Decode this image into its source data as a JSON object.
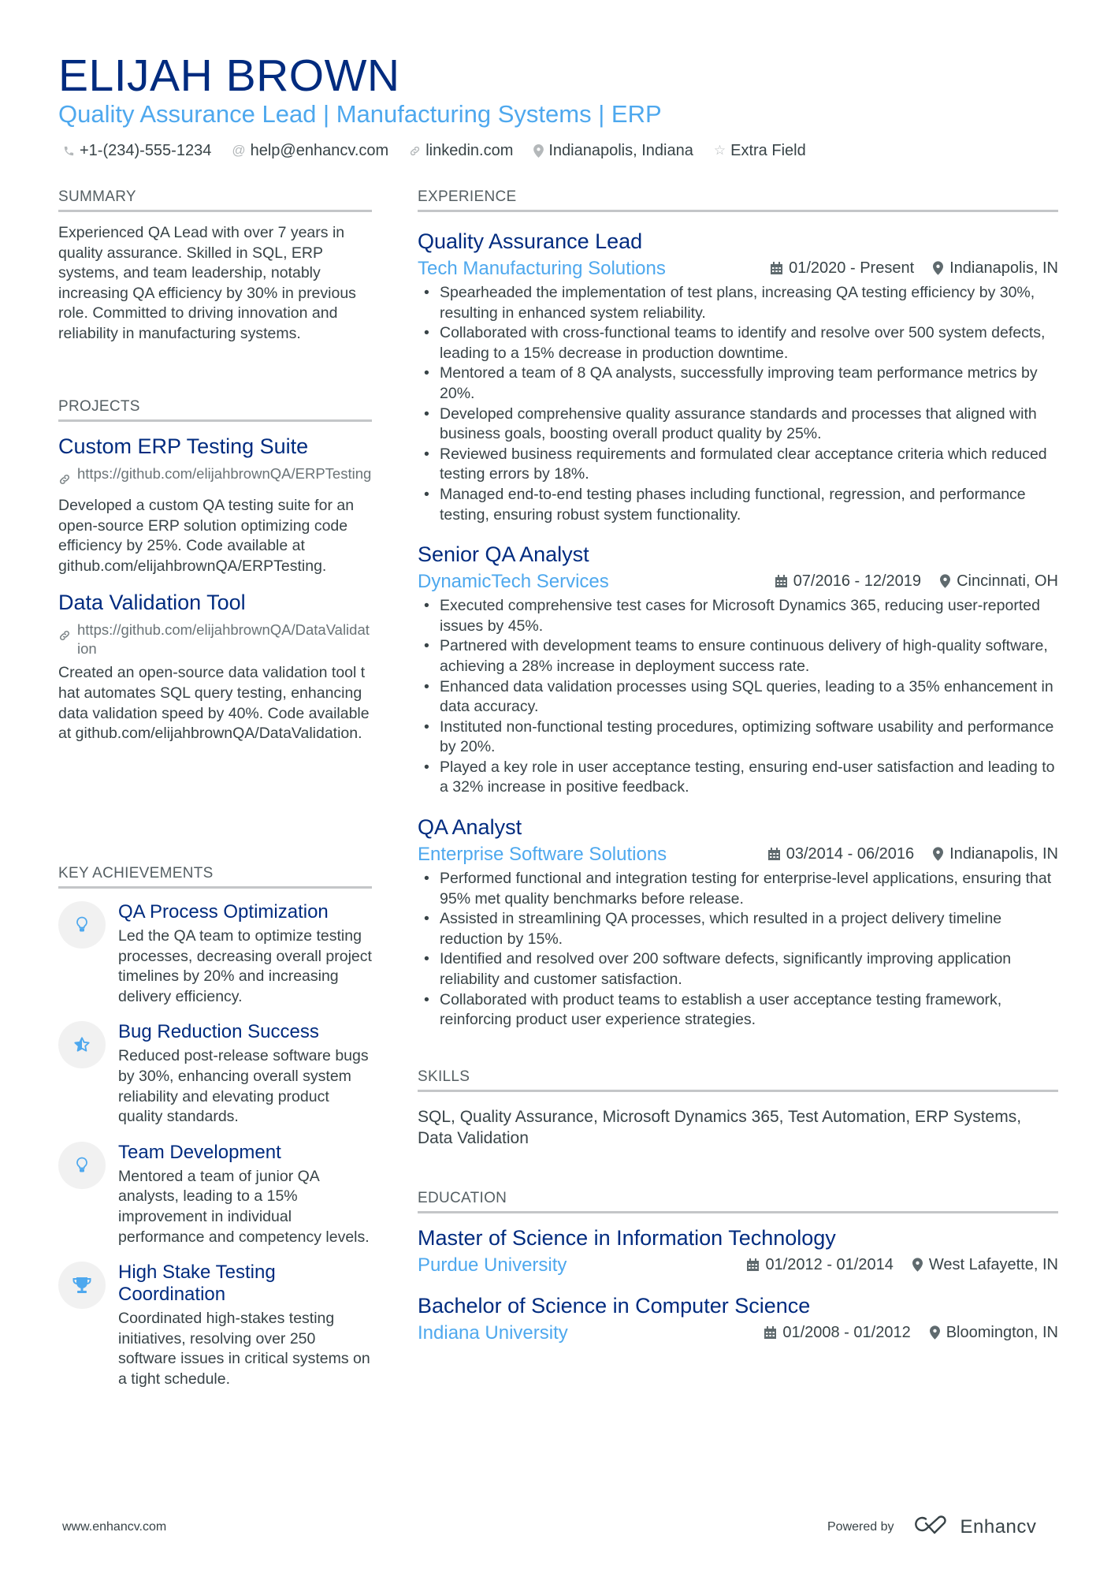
{
  "header": {
    "name": "ELIJAH BROWN",
    "headline": "Quality Assurance Lead | Manufacturing Systems | ERP",
    "contacts": [
      {
        "icon": "phone-icon",
        "text": "+1-(234)-555-1234"
      },
      {
        "icon": "at-icon",
        "text": "help@enhancv.com"
      },
      {
        "icon": "link-icon",
        "text": "linkedin.com"
      },
      {
        "icon": "location-icon",
        "text": "Indianapolis, Indiana"
      },
      {
        "icon": "star-icon",
        "text": "Extra Field"
      }
    ]
  },
  "colors": {
    "name": "#002b7f",
    "accent": "#4ea8ee",
    "text": "#384347",
    "section_rule": "#c4c6c8",
    "icon_bg": "#f1f1f1"
  },
  "summary": {
    "title": "SUMMARY",
    "text": "Experienced QA Lead with over 7 years in quality assurance. Skilled in SQL, ERP systems, and team leadership, notably increasing QA efficiency by 30% in previous role. Committed to driving innovation and reliability in manufacturing systems."
  },
  "projects": {
    "title": "PROJECTS",
    "items": [
      {
        "title": "Custom ERP Testing Suite",
        "link": "https://github.com/elijahbrownQA/ERPTesting",
        "description": "Developed a custom QA testing suite for an open-source ERP solution optimizing code efficiency by 25%. Code available at github.com/elijahbrownQA/ERPTesting."
      },
      {
        "title": "Data Validation Tool",
        "link": "https://github.com/elijahbrownQA/DataValidation",
        "description": "Created an open-source data validation tool that automates SQL query testing, enhancing data validation speed by 40%. Code available at github.com/elijahbrownQA/DataValidation."
      }
    ]
  },
  "achievements": {
    "title": "KEY ACHIEVEMENTS",
    "items": [
      {
        "icon": "lightbulb-icon",
        "title": "QA Process Optimization",
        "description": "Led the QA team to optimize testing processes, decreasing overall project timelines by 20% and increasing delivery efficiency."
      },
      {
        "icon": "star-half-icon",
        "title": "Bug Reduction Success",
        "description": "Reduced post-release software bugs by 30%, enhancing overall system reliability and elevating product quality standards."
      },
      {
        "icon": "lightbulb-icon",
        "title": "Team Development",
        "description": "Mentored a team of junior QA analysts, leading to a 15% improvement in individual performance and competency levels."
      },
      {
        "icon": "trophy-icon",
        "title": "High Stake Testing Coordination",
        "description": "Coordinated high-stakes testing initiatives, resolving over 250 software issues in critical systems on a tight schedule."
      }
    ]
  },
  "experience": {
    "title": "EXPERIENCE",
    "items": [
      {
        "role": "Quality Assurance Lead",
        "company": "Tech Manufacturing Solutions",
        "dates": "01/2020 - Present",
        "location": "Indianapolis, IN",
        "bullets": [
          "Spearheaded the implementation of test plans, increasing QA testing efficiency by 30%, resulting in enhanced system reliability.",
          "Collaborated with cross-functional teams to identify and resolve over 500 system defects, leading to a 15% decrease in production downtime.",
          "Mentored a team of 8 QA analysts, successfully improving team performance metrics by 20%.",
          "Developed comprehensive quality assurance standards and processes that aligned with business goals, boosting overall product quality by 25%.",
          "Reviewed business requirements and formulated clear acceptance criteria which reduced testing errors by 18%.",
          "Managed end-to-end testing phases including functional, regression, and performance testing, ensuring robust system functionality."
        ]
      },
      {
        "role": "Senior QA Analyst",
        "company": "DynamicTech Services",
        "dates": "07/2016 - 12/2019",
        "location": "Cincinnati, OH",
        "bullets": [
          "Executed comprehensive test cases for Microsoft Dynamics 365, reducing user-reported issues by 45%.",
          "Partnered with development teams to ensure continuous delivery of high-quality software, achieving a 28% increase in deployment success rate.",
          "Enhanced data validation processes using SQL queries, leading to a 35% enhancement in data accuracy.",
          "Instituted non-functional testing procedures, optimizing software usability and performance by 20%.",
          "Played a key role in user acceptance testing, ensuring end-user satisfaction and leading to a 32% increase in positive feedback."
        ]
      },
      {
        "role": "QA Analyst",
        "company": "Enterprise Software Solutions",
        "dates": "03/2014 - 06/2016",
        "location": "Indianapolis, IN",
        "bullets": [
          "Performed functional and integration testing for enterprise-level applications, ensuring that 95% met quality benchmarks before release.",
          "Assisted in streamlining QA processes, which resulted in a project delivery timeline reduction by 15%.",
          "Identified and resolved over 200 software defects, significantly improving application reliability and customer satisfaction.",
          "Collaborated with product teams to establish a user acceptance testing framework, reinforcing product user experience strategies."
        ]
      }
    ]
  },
  "skills": {
    "title": "SKILLS",
    "text": "SQL, Quality Assurance, Microsoft Dynamics 365, Test Automation, ERP Systems, Data Validation"
  },
  "education": {
    "title": "EDUCATION",
    "items": [
      {
        "degree": "Master of Science in Information Technology",
        "school": "Purdue University",
        "dates": "01/2012 - 01/2014",
        "location": "West Lafayette, IN"
      },
      {
        "degree": "Bachelor of Science in Computer Science",
        "school": "Indiana University",
        "dates": "01/2008 - 01/2012",
        "location": "Bloomington, IN"
      }
    ]
  },
  "footer": {
    "website": "www.enhancv.com",
    "powered_by": "Powered by",
    "brand": "Enhancv"
  }
}
